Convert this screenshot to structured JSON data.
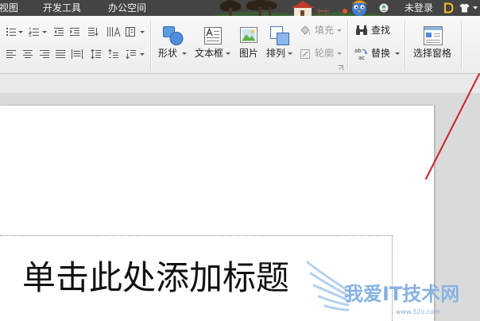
{
  "menu": {
    "tabs": [
      "视图",
      "开发工具",
      "办公空间"
    ],
    "login_status": "未登录",
    "icons": [
      "user-avatar-icon",
      "docer-icon",
      "skin-icon",
      "chevron-down-icon"
    ]
  },
  "ribbon": {
    "paragraph_icons": [
      "bullet-list-icon",
      "numbered-list-icon",
      "decrease-indent-icon",
      "increase-indent-icon",
      "text-direction-icon",
      "text-columns-icon",
      "text-box-align-icon",
      "align-left-icon",
      "align-center-icon",
      "align-right-icon",
      "justify-icon",
      "distributed-align-icon",
      "line-spacing-icon",
      "paragraph-spacing-before-icon",
      "paragraph-spacing-after-icon"
    ],
    "shape": {
      "label": "形状",
      "icon": "shapes-icon"
    },
    "textbox": {
      "label": "文本框",
      "icon": "textbox-icon"
    },
    "picture": {
      "label": "图片",
      "icon": "picture-icon"
    },
    "arrange": {
      "label": "排列",
      "icon": "arrange-icon"
    },
    "fill": {
      "label": "填充",
      "icon": "fill-bucket-icon",
      "enabled": false
    },
    "outline": {
      "label": "轮廓",
      "icon": "outline-pen-icon",
      "enabled": false
    },
    "find": {
      "label": "查找",
      "icon": "binoculars-icon"
    },
    "replace": {
      "label": "替换",
      "icon": "replace-icon",
      "glyph": [
        "ab",
        "ac"
      ]
    },
    "selection_pane": {
      "label": "选择窗格",
      "icon": "selection-pane-icon"
    }
  },
  "slide": {
    "title_placeholder": "单击此处添加标题"
  },
  "watermark": {
    "site_name": "我爱IT技术网",
    "url": "www.52ij.com"
  },
  "colors": {
    "menu_bar": "#444444",
    "ribbon": "#f2f2f2",
    "workspace": "#dadada",
    "slide": "#ffffff",
    "annotation_line": "#cc2229",
    "disabled_text": "#9a9a9a",
    "accent_blue": "#4f8fdc"
  }
}
